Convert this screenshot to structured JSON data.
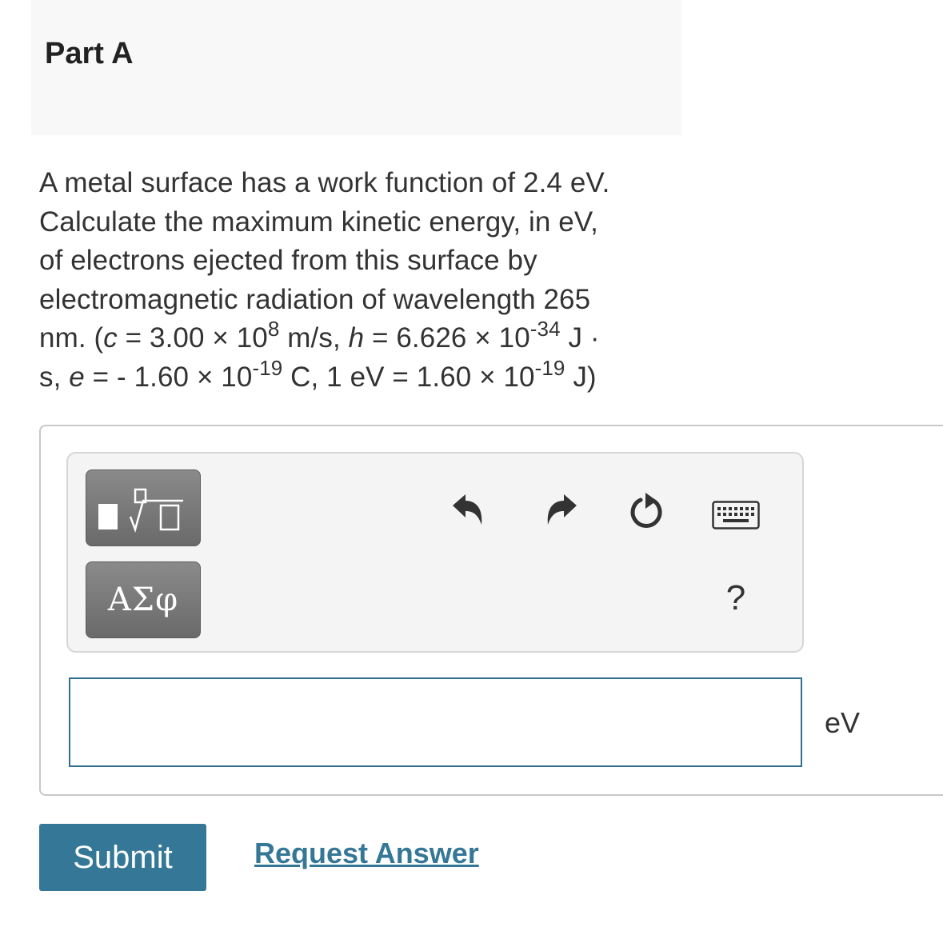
{
  "part": {
    "title": "Part A"
  },
  "question": {
    "line1": "A metal surface has a work function of 2.4 eV.",
    "line2": "Calculate the maximum kinetic energy, in eV,",
    "line3": "of electrons ejected from this surface by",
    "line4": "electromagnetic radiation of wavelength 265",
    "l5_a": "nm. (",
    "l5_c": "c",
    "l5_b": " = 3.00 × 10",
    "l5_exp1": "8",
    "l5_d": " m/s, ",
    "l5_h": "h",
    "l5_e": " = 6.626 × 10",
    "l5_exp2": "-34",
    "l5_f": " J ·",
    "l6_a": "s, ",
    "l6_e": "e",
    "l6_b": " = - 1.60 × 10",
    "l6_exp1": "-19",
    "l6_c": " C, 1 eV = 1.60 × 10",
    "l6_exp2": "-19",
    "l6_d": " J)"
  },
  "toolbar": {
    "templates_icon": "fraction-sqrt-templates-icon",
    "symbols_label": "ΑΣφ",
    "undo_icon": "undo-icon",
    "redo_icon": "redo-icon",
    "reset_icon": "reset-icon",
    "keyboard_icon": "keyboard-icon",
    "help_label": "?"
  },
  "answer": {
    "value": "",
    "unit": "eV"
  },
  "actions": {
    "submit_label": "Submit",
    "request_label": "Request Answer"
  },
  "colors": {
    "accent": "#357797",
    "input_border": "#2f6f8f",
    "header_bg": "#f8f8f8"
  }
}
